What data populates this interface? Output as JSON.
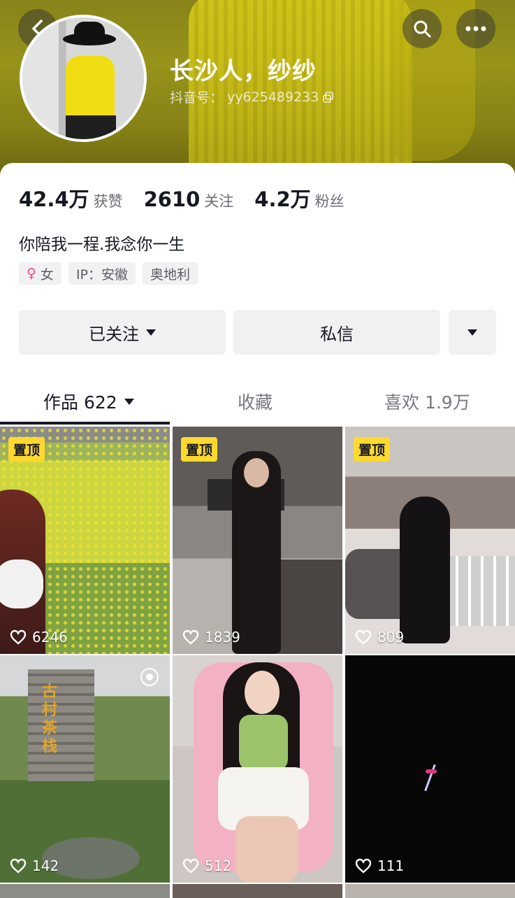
{
  "header": {
    "username": "长沙人，纱纱",
    "douyin_id_label": "抖音号：",
    "douyin_id": "yy625489233"
  },
  "icons": {
    "back": "back-chevron-icon",
    "search": "search-icon",
    "more": "more-dots-icon",
    "copy": "copy-icon",
    "female": "female-icon",
    "heart": "heart-outline-icon",
    "live": "live-icon"
  },
  "stats": [
    {
      "value": "42.4万",
      "label": "获赞"
    },
    {
      "value": "2610",
      "label": "关注"
    },
    {
      "value": "4.2万",
      "label": "粉丝"
    }
  ],
  "bio": "你陪我一程.我念你一生",
  "tags": {
    "gender": "女",
    "ip": "IP：安徽",
    "location": "奥地利"
  },
  "actions": {
    "follow": "已关注",
    "message": "私信"
  },
  "tabs": {
    "works": "作品 622",
    "favorites": "收藏",
    "likes": "喜欢 1.9万"
  },
  "grid": {
    "pinned_label": "置顶",
    "items": [
      {
        "likes": "6246",
        "pinned": true
      },
      {
        "likes": "1839",
        "pinned": true
      },
      {
        "likes": "809",
        "pinned": true
      },
      {
        "likes": "142",
        "pinned": false
      },
      {
        "likes": "512",
        "pinned": false
      },
      {
        "likes": "111",
        "pinned": false
      }
    ],
    "sign_text": "古村茶栈"
  },
  "colors": {
    "accent_pin": "#ffd92e",
    "female": "#ef4b92",
    "text_primary": "#161823",
    "text_secondary": "#6b6d75"
  }
}
